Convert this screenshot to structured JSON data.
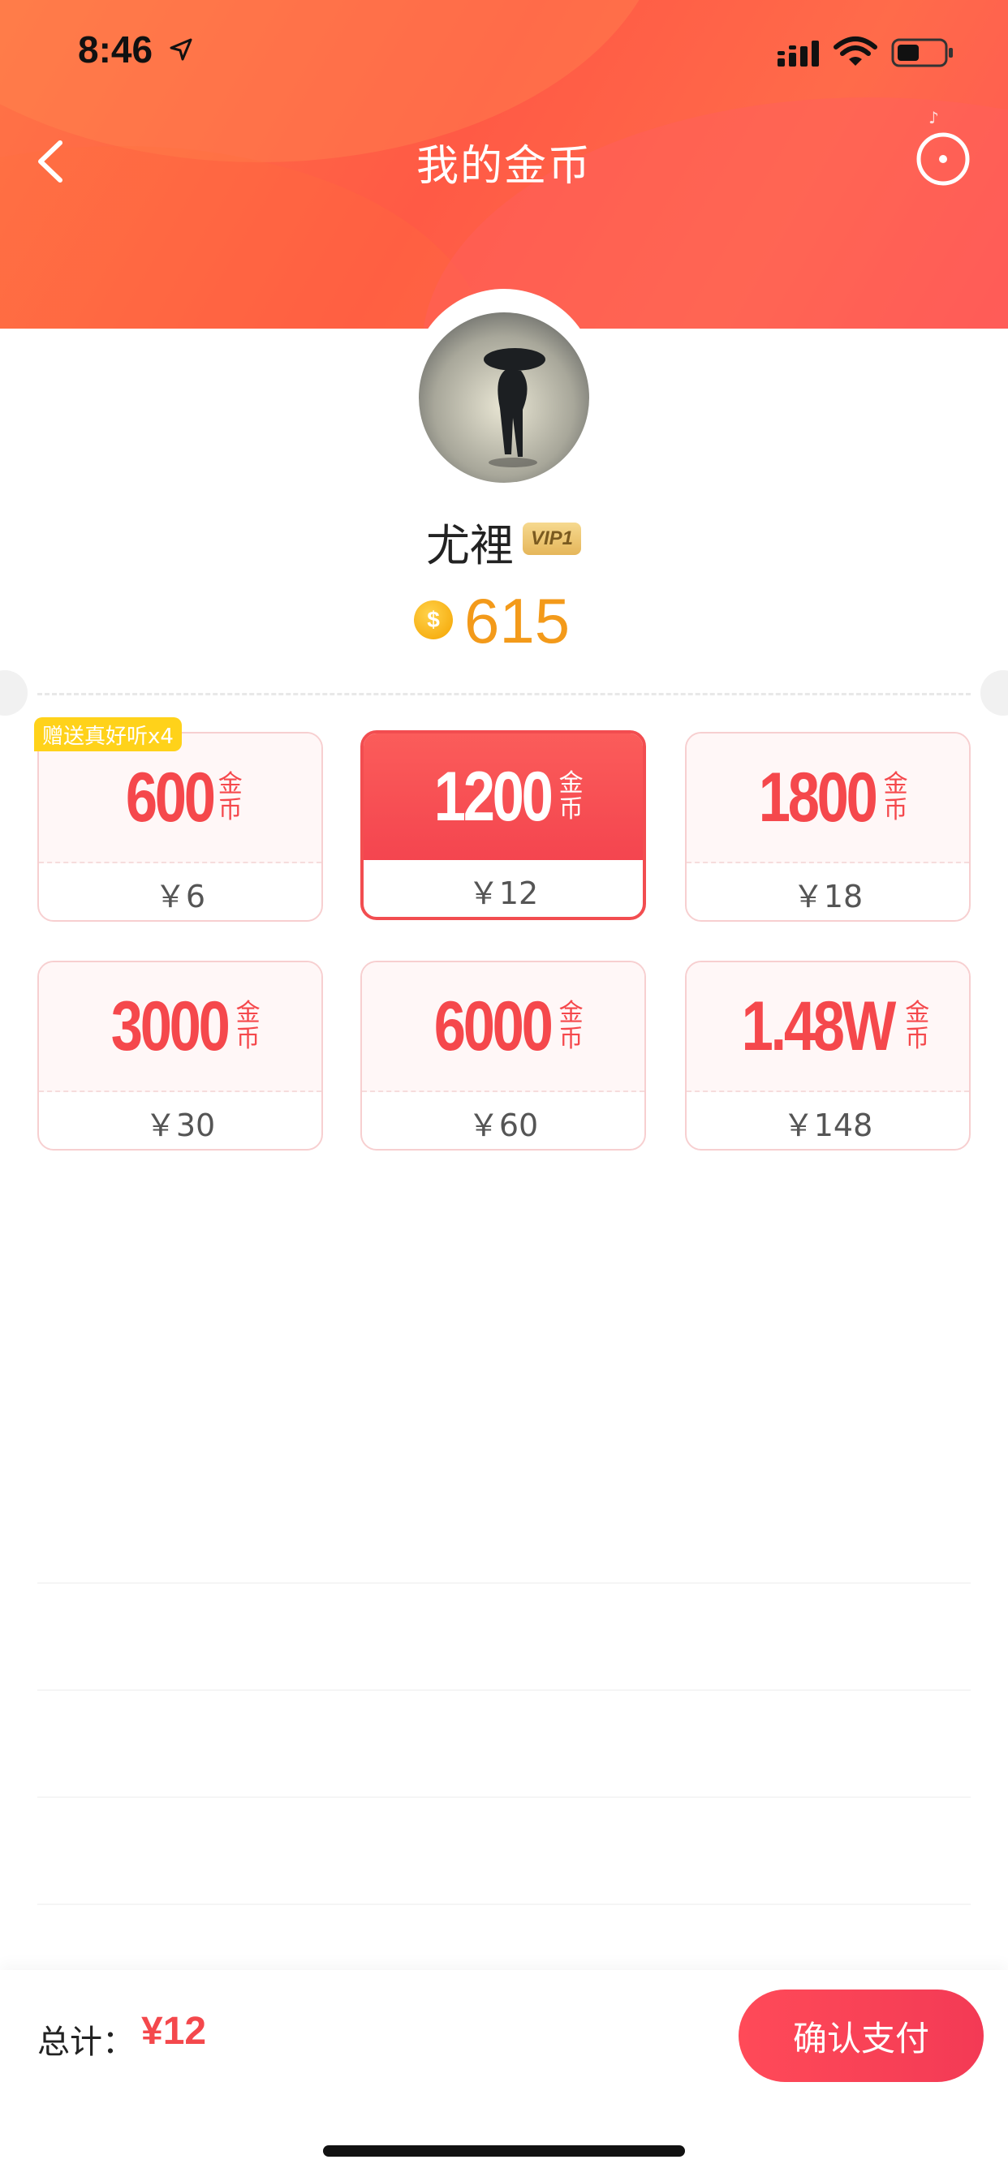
{
  "status_bar": {
    "time": "8:46"
  },
  "header": {
    "title": "我的金币",
    "back_icon": "chevron-left-icon",
    "music_icon": "music-disc-icon"
  },
  "profile": {
    "name": "尤裡",
    "vip": "VIP1",
    "coin_icon": "$",
    "balance": "615"
  },
  "gift_tag": "赠送真好听x4",
  "packages": [
    {
      "amount": "600",
      "unit": "金币",
      "price": "￥6",
      "selected": false
    },
    {
      "amount": "1200",
      "unit": "金币",
      "price": "￥12",
      "selected": true
    },
    {
      "amount": "1800",
      "unit": "金币",
      "price": "￥18",
      "selected": false
    },
    {
      "amount": "3000",
      "unit": "金币",
      "price": "￥30",
      "selected": false
    },
    {
      "amount": "6000",
      "unit": "金币",
      "price": "￥60",
      "selected": false
    },
    {
      "amount": "1.48W",
      "unit": "金币",
      "price": "￥148",
      "selected": false
    }
  ],
  "footer": {
    "total_label": "总计：",
    "total_value": "¥12",
    "pay_button": "确认支付"
  },
  "colors": {
    "accent": "#f4484c",
    "coin": "#f39a1a",
    "gift": "#ffd21a"
  }
}
